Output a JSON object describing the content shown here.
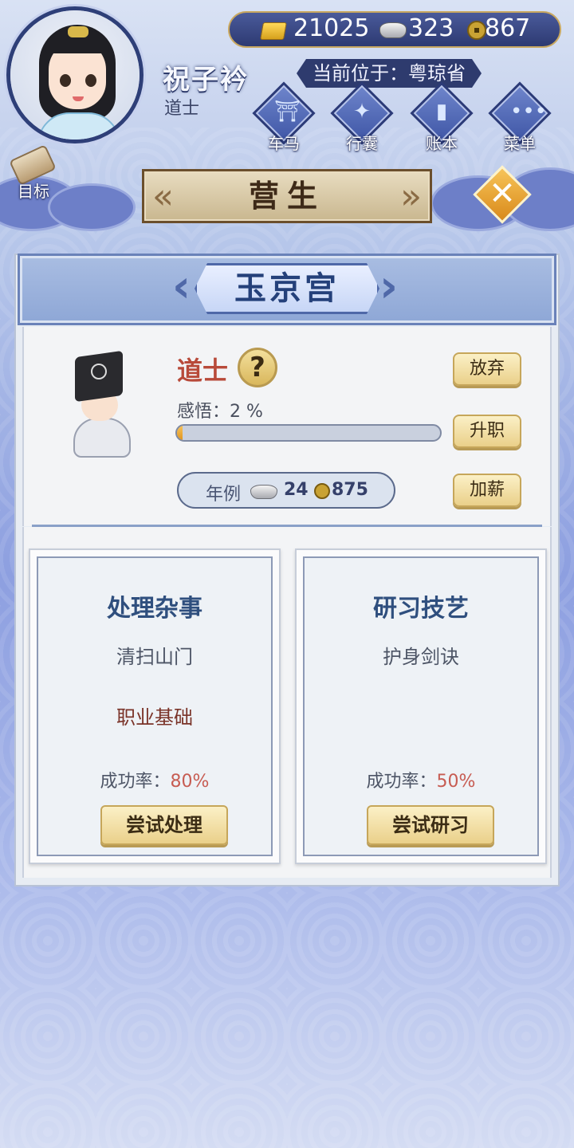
{
  "player": {
    "name": "祝子衿",
    "title": "道士"
  },
  "currency": {
    "gold": "21025",
    "silver": "323",
    "coin": "867"
  },
  "location": "当前位于：粤琼省",
  "nav": {
    "carriage": "车马",
    "luggage": "行囊",
    "ledger": "账本",
    "menu": "菜单",
    "goal": "目标"
  },
  "section_title": "营生",
  "workplace": "玉京宫",
  "job": {
    "name": "道士",
    "help": "?",
    "insight_label": "感悟：",
    "insight_value": "2 %",
    "insight_progress": 0.02,
    "salary_label": "年例",
    "salary_silver": "24",
    "salary_coin": "875",
    "quit": "放弃",
    "promote": "升职",
    "raise": "加薪"
  },
  "cards": [
    {
      "title": "处理杂事",
      "sub": "清扫山门",
      "tag": "职业基础",
      "rate_label": "成功率：",
      "rate_value": "80%",
      "button": "尝试处理"
    },
    {
      "title": "研习技艺",
      "sub": "护身剑诀",
      "tag": "",
      "rate_label": "成功率：",
      "rate_value": "50%",
      "button": "尝试研习"
    }
  ],
  "colors": {
    "accent_gold": "#e0951f",
    "title_blue": "#2f4f7e",
    "job_red": "#b84a3a"
  },
  "icons": {
    "gold": "gold-ingot-icon",
    "silver": "silver-ingot-icon",
    "coin": "copper-coin-icon",
    "close": "close-icon",
    "help": "question-icon"
  }
}
